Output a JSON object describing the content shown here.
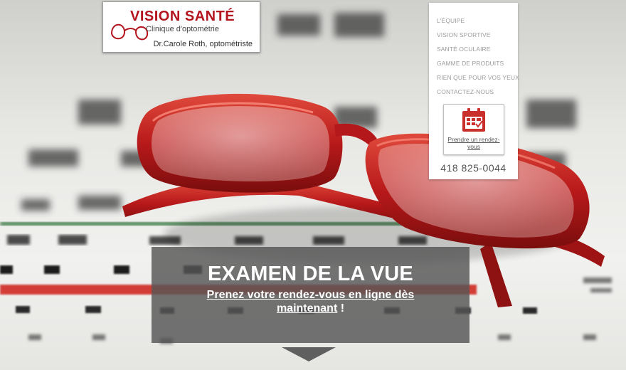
{
  "logo": {
    "title": "VISION SANTÉ",
    "subtitle": "Clinique d'optométrie",
    "doctor": "Dr.Carole Roth, optométriste"
  },
  "nav": {
    "items": [
      {
        "label": "L'Équipe"
      },
      {
        "label": "Vision sportive"
      },
      {
        "label": "Santé oculaire"
      },
      {
        "label": "Gamme de produits"
      },
      {
        "label": "Rien que pour vos yeux"
      },
      {
        "label": "Contactez-nous"
      }
    ],
    "appointment": {
      "label": "Prendre un rendez-vous",
      "icon": "calendar-icon"
    },
    "phone": "418 825-0044"
  },
  "hero": {
    "title": "EXAMEN DE LA VUE",
    "subtitle_link": "Prenez votre rendez-vous en ligne dès maintenant",
    "subtitle_suffix": " !"
  },
  "colors": {
    "brand_red": "#b3141d",
    "hero_band": "#555555"
  }
}
